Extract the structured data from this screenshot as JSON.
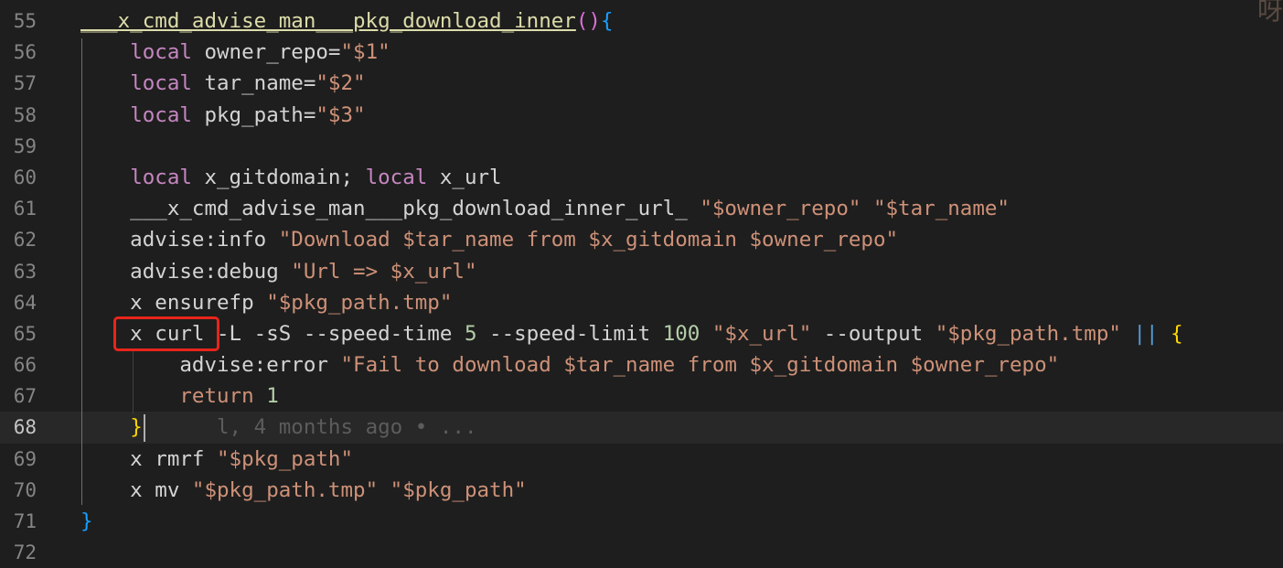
{
  "editor": {
    "lines": [
      {
        "n": "55",
        "tokens": [
          {
            "t": "___x_cmd_advise_man___pkg_download_inner",
            "c": "fn"
          },
          {
            "t": "(",
            "c": "paren"
          },
          {
            "t": ")",
            "c": "paren"
          },
          {
            "t": "{",
            "c": "brace3"
          }
        ]
      },
      {
        "n": "56",
        "tokens": [
          {
            "t": "    "
          },
          {
            "t": "local",
            "c": "kwblue"
          },
          {
            "t": " owner_repo=",
            "c": "plain"
          },
          {
            "t": "\"$1\"",
            "c": "str"
          }
        ]
      },
      {
        "n": "57",
        "tokens": [
          {
            "t": "    "
          },
          {
            "t": "local",
            "c": "kwblue"
          },
          {
            "t": " tar_name=",
            "c": "plain"
          },
          {
            "t": "\"$2\"",
            "c": "str"
          }
        ]
      },
      {
        "n": "58",
        "tokens": [
          {
            "t": "    "
          },
          {
            "t": "local",
            "c": "kwblue"
          },
          {
            "t": " pkg_path=",
            "c": "plain"
          },
          {
            "t": "\"$3\"",
            "c": "str"
          }
        ]
      },
      {
        "n": "59",
        "tokens": []
      },
      {
        "n": "60",
        "tokens": [
          {
            "t": "    "
          },
          {
            "t": "local",
            "c": "kwblue"
          },
          {
            "t": " x_gitdomain; ",
            "c": "plain"
          },
          {
            "t": "local",
            "c": "kwblue"
          },
          {
            "t": " x_url",
            "c": "plain"
          }
        ]
      },
      {
        "n": "61",
        "tokens": [
          {
            "t": "    ___x_cmd_advise_man___pkg_download_inner_url_ ",
            "c": "plain"
          },
          {
            "t": "\"$owner_repo\"",
            "c": "str"
          },
          {
            "t": " ",
            "c": "plain"
          },
          {
            "t": "\"$tar_name\"",
            "c": "str"
          }
        ]
      },
      {
        "n": "62",
        "tokens": [
          {
            "t": "    advise:info ",
            "c": "plain"
          },
          {
            "t": "\"Download $tar_name from $x_gitdomain $owner_repo\"",
            "c": "str"
          }
        ]
      },
      {
        "n": "63",
        "tokens": [
          {
            "t": "    advise:debug ",
            "c": "plain"
          },
          {
            "t": "\"Url => $x_url\"",
            "c": "str"
          }
        ]
      },
      {
        "n": "64",
        "tokens": [
          {
            "t": "    x ensurefp ",
            "c": "plain"
          },
          {
            "t": "\"$pkg_path.tmp\"",
            "c": "str"
          }
        ]
      },
      {
        "n": "65",
        "tokens": [
          {
            "t": "    x curl -L -sS --speed-time ",
            "c": "plain"
          },
          {
            "t": "5",
            "c": "num"
          },
          {
            "t": " --speed-limit ",
            "c": "plain"
          },
          {
            "t": "100",
            "c": "num"
          },
          {
            "t": " ",
            "c": "plain"
          },
          {
            "t": "\"$x_url\"",
            "c": "str"
          },
          {
            "t": " --output ",
            "c": "plain"
          },
          {
            "t": "\"$pkg_path.tmp\"",
            "c": "str"
          },
          {
            "t": " ",
            "c": "plain"
          },
          {
            "t": "||",
            "c": "op"
          },
          {
            "t": " ",
            "c": "plain"
          },
          {
            "t": "{",
            "c": "brace"
          }
        ]
      },
      {
        "n": "66",
        "tokens": [
          {
            "t": "        advise:error ",
            "c": "plain"
          },
          {
            "t": "\"Fail to download $tar_name from $x_gitdomain $owner_repo\"",
            "c": "str"
          }
        ]
      },
      {
        "n": "67",
        "tokens": [
          {
            "t": "        "
          },
          {
            "t": "return",
            "c": "str"
          },
          {
            "t": " ",
            "c": "plain"
          },
          {
            "t": "1",
            "c": "num"
          }
        ]
      },
      {
        "n": "68",
        "current": true,
        "tokens": [
          {
            "t": "    "
          },
          {
            "t": "}",
            "c": "brace"
          }
        ],
        "blame": "l, 4 months ago • ..."
      },
      {
        "n": "69",
        "tokens": [
          {
            "t": "    x rmrf ",
            "c": "plain"
          },
          {
            "t": "\"$pkg_path\"",
            "c": "str"
          }
        ]
      },
      {
        "n": "70",
        "tokens": [
          {
            "t": "    x mv ",
            "c": "plain"
          },
          {
            "t": "\"$pkg_path.tmp\"",
            "c": "str"
          },
          {
            "t": " ",
            "c": "plain"
          },
          {
            "t": "\"$pkg_path\"",
            "c": "str"
          }
        ]
      },
      {
        "n": "71",
        "tokens": [
          {
            "t": "}",
            "c": "brace3"
          }
        ]
      },
      {
        "n": "72",
        "tokens": []
      }
    ],
    "corner_glyph": "呀"
  },
  "colors": {
    "background": "#1e1e1e",
    "highlight_box": "#e8251b"
  }
}
